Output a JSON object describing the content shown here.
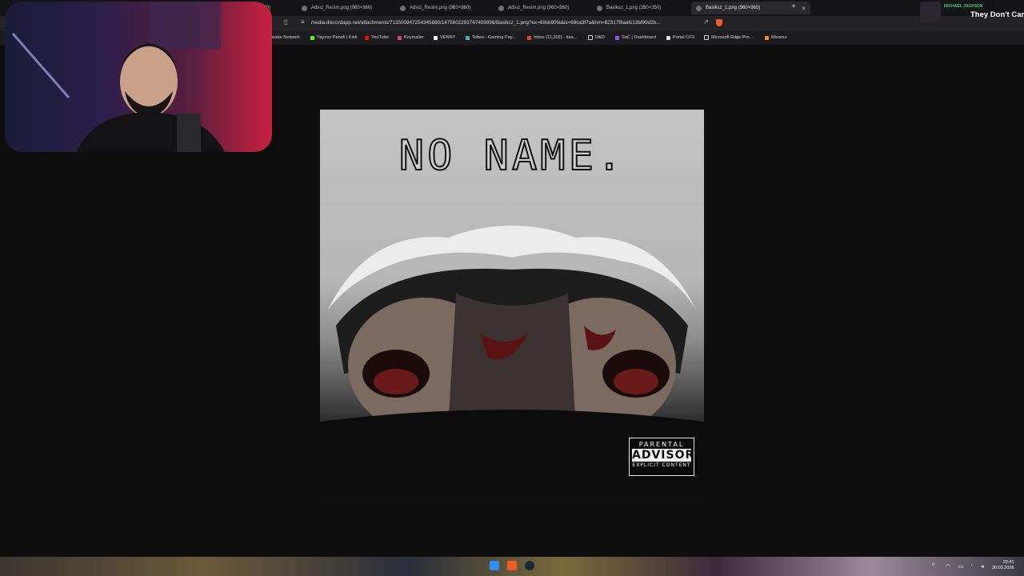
{
  "tabs": [
    {
      "label": "960)"
    },
    {
      "label": "Adsız_Resim.png (960×960)"
    },
    {
      "label": "Adsız_Resim.png (960×960)"
    },
    {
      "label": "Adsız_Resim.png (960×960)"
    },
    {
      "label": "Baslksz_1.png (350×350)"
    },
    {
      "label": "Baslksz_1.png (960×960)",
      "active": true
    }
  ],
  "address": {
    "url": "media.discordapp.net/attachments/713500947254345880/1475602293767409996/Baslksz_1.png?ex=69cb90fa&is=69ca3f7a&hm=82317f8aafc13bf99d2b..."
  },
  "bookmarks": [
    {
      "label": "eator Network"
    },
    {
      "label": "Yayıncı Paneli | Kick"
    },
    {
      "label": "YouTube"
    },
    {
      "label": "Keymailer"
    },
    {
      "label": "VENNY"
    },
    {
      "label": "Tebex - Gaming Pay..."
    },
    {
      "label": "Inbox (11,202) - kaa..."
    },
    {
      "label": "D&D"
    },
    {
      "label": "SaC | Dashboard"
    },
    {
      "label": "Portal CFX"
    },
    {
      "label": "Microsoft Edge Pro..."
    },
    {
      "label": "Mixamo"
    }
  ],
  "image": {
    "title": "NO NAME.",
    "advisory": {
      "line1": "PARENTAL",
      "line2": "ADVISORY",
      "line3": "EXPLICIT CONTENT"
    }
  },
  "now_playing": {
    "artist": "MICHAEL JACKSON",
    "title": "They Don't Care"
  },
  "clock": {
    "time": "22:41",
    "date": "30.03.2026"
  },
  "colors": {
    "accent": "#f05a24",
    "spotify_green": "#43d17a"
  },
  "icons": [
    "bookmark-icon",
    "share-icon",
    "brave-shield-icon",
    "windows-start-icon",
    "brave-taskbar-icon",
    "steam-taskbar-icon",
    "wifi-icon",
    "volume-icon"
  ]
}
